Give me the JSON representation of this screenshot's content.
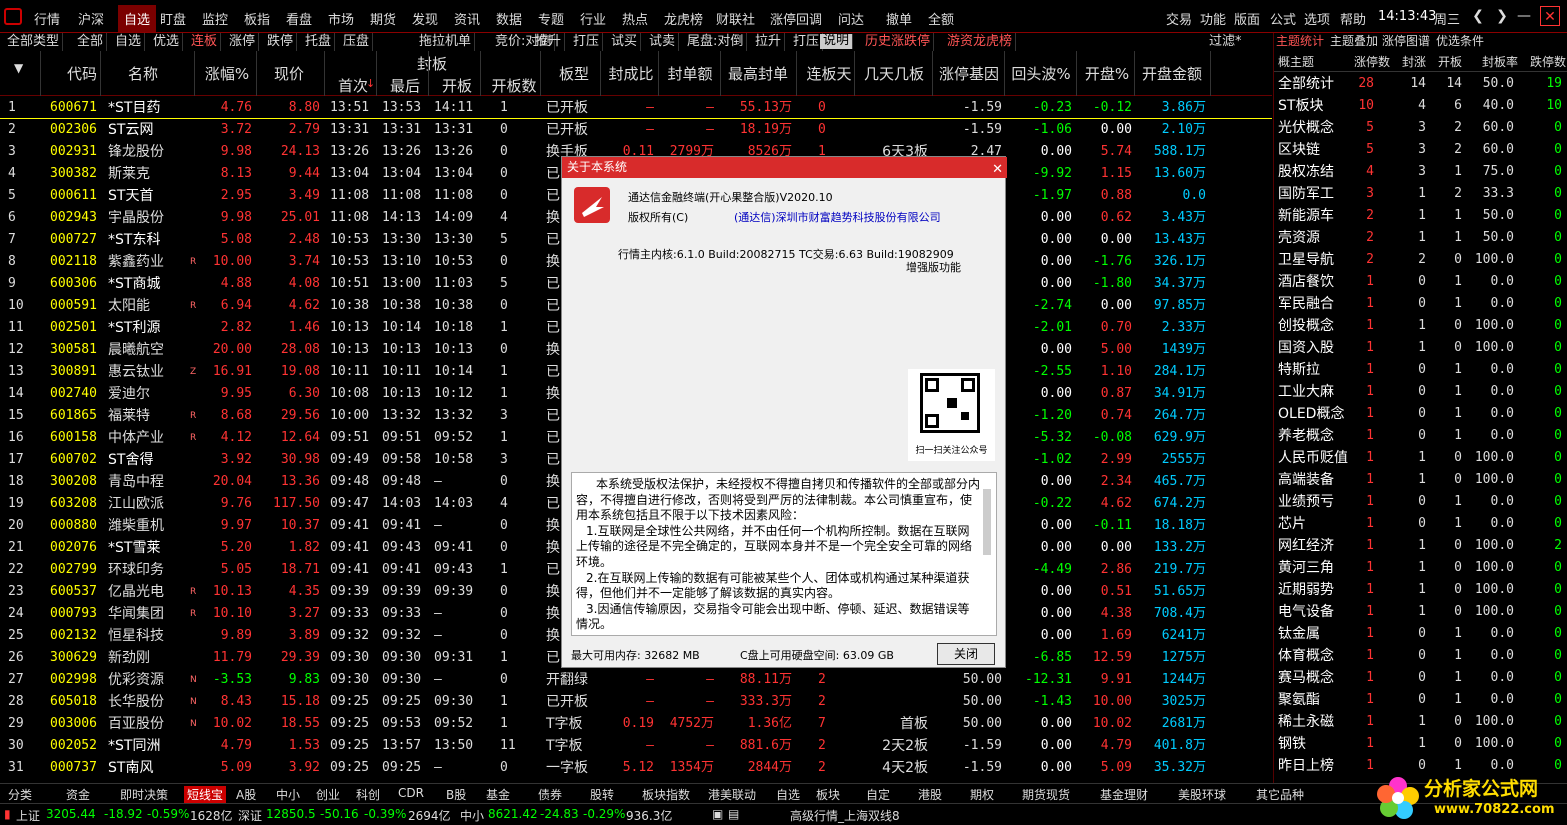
{
  "menu": {
    "items": [
      "行情",
      "沪深",
      "自选",
      "盯盘",
      "监控",
      "板指",
      "看盘",
      "市场",
      "期货",
      "发现",
      "资讯",
      "数据",
      "专题",
      "行业",
      "热点",
      "龙虎榜",
      "财联社",
      "涨停回调",
      "问达",
      "撤单",
      "全额"
    ],
    "right": [
      "交易",
      "功能",
      "版面",
      "公式",
      "选项",
      "帮助"
    ],
    "time": "14:13:43",
    "weekday": "周三"
  },
  "filter": {
    "items": [
      "全部类型",
      "全部",
      "自选",
      "优选",
      "连板",
      "涨停",
      "跌停",
      "托盘",
      "压盘",
      "拖拉机单",
      "竞价:对倒",
      "拉升",
      "打压",
      "试买",
      "试卖",
      "尾盘:对倒",
      "拉升",
      "打压",
      "说明",
      "历史涨跌停",
      "游资龙虎榜"
    ],
    "right": "过滤*"
  },
  "table": {
    "headers": [
      "代码",
      "名称",
      "涨幅%",
      "现价",
      "封板",
      "首次",
      "最后",
      "开板",
      "开板数",
      "板型",
      "封成比",
      "封单额",
      "最高封单",
      "连板天",
      "几天几板",
      "涨停基因",
      "回头波%",
      "开盘%",
      "开盘金额"
    ],
    "rows": [
      [
        "1",
        "600671",
        "*ST目药",
        "",
        "4.76",
        "8.80",
        "13:51",
        "13:53",
        "14:11",
        "1",
        "已开板",
        "–",
        "–",
        "55.13万",
        "0",
        "",
        "-1.59",
        "-0.23",
        "-0.12",
        "3.86万"
      ],
      [
        "2",
        "002306",
        "ST云网",
        "",
        "3.72",
        "2.79",
        "13:31",
        "13:31",
        "13:31",
        "0",
        "已开板",
        "–",
        "–",
        "18.19万",
        "0",
        "",
        "-1.59",
        "-1.06",
        "0.00",
        "2.10万"
      ],
      [
        "3",
        "002931",
        "锋龙股份",
        "",
        "9.98",
        "24.13",
        "13:26",
        "13:26",
        "13:26",
        "0",
        "换手板",
        "0.11",
        "2799万",
        "8526万",
        "1",
        "6天3板",
        "2.47",
        "0.00",
        "5.74",
        "588.1万"
      ],
      [
        "4",
        "300382",
        "斯莱克",
        "",
        "8.13",
        "9.44",
        "13:04",
        "13:04",
        "13:04",
        "0",
        "已",
        "",
        "",
        "",
        "",
        "",
        "",
        "-9.92",
        "1.15",
        "13.60万"
      ],
      [
        "5",
        "000611",
        "ST天首",
        "",
        "2.95",
        "3.49",
        "11:08",
        "11:08",
        "11:08",
        "0",
        "已",
        "",
        "",
        "",
        "",
        "",
        "",
        "-1.97",
        "0.88",
        "0.0"
      ],
      [
        "6",
        "002943",
        "宇晶股份",
        "",
        "9.98",
        "25.01",
        "11:08",
        "14:13",
        "14:09",
        "4",
        "换",
        "",
        "",
        "",
        "",
        "",
        "",
        "0.00",
        "0.62",
        "3.43万"
      ],
      [
        "7",
        "000727",
        "*ST东科",
        "",
        "5.08",
        "2.48",
        "10:53",
        "13:30",
        "13:30",
        "5",
        "已",
        "",
        "",
        "",
        "",
        "",
        "",
        "0.00",
        "0.00",
        "13.43万"
      ],
      [
        "8",
        "002118",
        "紫鑫药业",
        "R",
        "10.00",
        "3.74",
        "10:53",
        "13:10",
        "10:53",
        "0",
        "换",
        "",
        "",
        "",
        "",
        "",
        "",
        "0.00",
        "-1.76",
        "326.1万"
      ],
      [
        "9",
        "600306",
        "*ST商城",
        "",
        "4.88",
        "4.08",
        "10:51",
        "13:00",
        "11:03",
        "5",
        "已",
        "",
        "",
        "",
        "",
        "",
        "",
        "0.00",
        "-1.80",
        "34.37万"
      ],
      [
        "10",
        "000591",
        "太阳能",
        "R",
        "6.94",
        "4.62",
        "10:38",
        "10:38",
        "10:38",
        "0",
        "已",
        "",
        "",
        "",
        "",
        "",
        "",
        "-2.74",
        "0.00",
        "97.85万"
      ],
      [
        "11",
        "002501",
        "*ST利源",
        "",
        "2.82",
        "1.46",
        "10:13",
        "10:14",
        "10:18",
        "1",
        "已",
        "",
        "",
        "",
        "",
        "",
        "",
        "-2.01",
        "0.70",
        "2.33万"
      ],
      [
        "12",
        "300581",
        "晨曦航空",
        "",
        "20.00",
        "28.08",
        "10:13",
        "10:13",
        "10:13",
        "0",
        "换",
        "",
        "",
        "",
        "",
        "",
        "",
        "0.00",
        "5.00",
        "1439万"
      ],
      [
        "13",
        "300891",
        "惠云钛业",
        "Z",
        "16.91",
        "19.08",
        "10:11",
        "10:11",
        "10:14",
        "1",
        "已",
        "",
        "",
        "",
        "",
        "",
        "",
        "-2.55",
        "1.10",
        "284.1万"
      ],
      [
        "14",
        "002740",
        "爱迪尔",
        "",
        "9.95",
        "6.30",
        "10:08",
        "10:13",
        "10:12",
        "1",
        "换",
        "",
        "",
        "",
        "",
        "",
        "",
        "0.00",
        "0.87",
        "34.91万"
      ],
      [
        "15",
        "601865",
        "福莱特",
        "R",
        "8.68",
        "29.56",
        "10:00",
        "13:32",
        "13:32",
        "3",
        "已",
        "",
        "",
        "",
        "",
        "",
        "",
        "-1.20",
        "0.74",
        "264.7万"
      ],
      [
        "16",
        "600158",
        "中体产业",
        "R",
        "4.12",
        "12.64",
        "09:51",
        "09:51",
        "09:52",
        "1",
        "已",
        "",
        "",
        "",
        "",
        "",
        "",
        "-5.32",
        "-0.08",
        "629.9万"
      ],
      [
        "17",
        "600702",
        "ST舍得",
        "",
        "3.92",
        "30.98",
        "09:49",
        "09:58",
        "10:58",
        "3",
        "已",
        "",
        "",
        "",
        "",
        "",
        "",
        "-1.02",
        "2.99",
        "2555万"
      ],
      [
        "18",
        "300208",
        "青岛中程",
        "",
        "20.04",
        "13.36",
        "09:48",
        "09:48",
        "–",
        "0",
        "换",
        "",
        "",
        "",
        "",
        "",
        "",
        "0.00",
        "2.34",
        "465.7万"
      ],
      [
        "19",
        "603208",
        "江山欧派",
        "",
        "9.76",
        "117.50",
        "09:47",
        "14:03",
        "14:03",
        "4",
        "已",
        "",
        "",
        "",
        "",
        "",
        "",
        "-0.22",
        "4.62",
        "674.2万"
      ],
      [
        "20",
        "000880",
        "潍柴重机",
        "",
        "9.97",
        "10.37",
        "09:41",
        "09:41",
        "–",
        "0",
        "换",
        "",
        "",
        "",
        "",
        "",
        "",
        "0.00",
        "-0.11",
        "18.18万"
      ],
      [
        "21",
        "002076",
        "*ST雪莱",
        "",
        "5.20",
        "1.82",
        "09:41",
        "09:43",
        "09:41",
        "0",
        "换",
        "",
        "",
        "",
        "",
        "",
        "",
        "0.00",
        "0.00",
        "133.2万"
      ],
      [
        "22",
        "002799",
        "环球印务",
        "",
        "5.05",
        "18.71",
        "09:41",
        "09:41",
        "09:43",
        "1",
        "已",
        "",
        "",
        "",
        "",
        "",
        "",
        "-4.49",
        "2.86",
        "219.7万"
      ],
      [
        "23",
        "600537",
        "亿晶光电",
        "R",
        "10.13",
        "4.35",
        "09:39",
        "09:39",
        "09:39",
        "0",
        "换",
        "",
        "",
        "",
        "",
        "",
        "",
        "0.00",
        "0.51",
        "51.65万"
      ],
      [
        "24",
        "000793",
        "华闻集团",
        "R",
        "10.10",
        "3.27",
        "09:33",
        "09:33",
        "–",
        "0",
        "换",
        "",
        "",
        "",
        "",
        "",
        "",
        "0.00",
        "4.38",
        "708.4万"
      ],
      [
        "25",
        "002132",
        "恒星科技",
        "",
        "9.89",
        "3.89",
        "09:32",
        "09:32",
        "–",
        "0",
        "换",
        "",
        "",
        "",
        "",
        "",
        "",
        "0.00",
        "1.69",
        "6241万"
      ],
      [
        "26",
        "300629",
        "新劲刚",
        "",
        "11.79",
        "29.39",
        "09:30",
        "09:30",
        "09:31",
        "1",
        "已",
        "",
        "",
        "",
        "",
        "",
        "",
        "-6.85",
        "12.59",
        "1275万"
      ],
      [
        "27",
        "002998",
        "优彩资源",
        "N",
        "-3.53",
        "9.83",
        "09:30",
        "09:30",
        "–",
        "0",
        "开翻绿",
        "–",
        "–",
        "88.11万",
        "2",
        "",
        "50.00",
        "-12.31",
        "9.91",
        "1244万"
      ],
      [
        "28",
        "605018",
        "长华股份",
        "N",
        "8.43",
        "15.18",
        "09:25",
        "09:25",
        "09:30",
        "1",
        "已开板",
        "–",
        "–",
        "333.3万",
        "2",
        "",
        "50.00",
        "-1.43",
        "10.00",
        "3025万"
      ],
      [
        "29",
        "003006",
        "百亚股份",
        "N",
        "10.02",
        "18.55",
        "09:25",
        "09:53",
        "09:52",
        "1",
        "T字板",
        "0.19",
        "4752万",
        "1.36亿",
        "7",
        "首板",
        "50.00",
        "0.00",
        "10.02",
        "2681万"
      ],
      [
        "30",
        "002052",
        "*ST同洲",
        "",
        "4.79",
        "1.53",
        "09:25",
        "13:57",
        "13:50",
        "11",
        "T字板",
        "–",
        "–",
        "881.6万",
        "2",
        "2天2板",
        "-1.59",
        "0.00",
        "4.79",
        "401.8万"
      ],
      [
        "31",
        "000737",
        "ST南风",
        "",
        "5.09",
        "3.92",
        "09:25",
        "09:25",
        "–",
        "0",
        "一字板",
        "5.12",
        "1354万",
        "2844万",
        "2",
        "4天2板",
        "-1.59",
        "0.00",
        "5.09",
        "35.32万"
      ]
    ]
  },
  "right_panel": {
    "tabs": [
      "主题统计",
      "主题叠加",
      "涨停图谱",
      "优选条件"
    ],
    "headers": [
      "概主题",
      "涨停数",
      "封涨",
      "开板",
      "封板率",
      "跌停数"
    ],
    "rows": [
      [
        "全部统计",
        "28",
        "14",
        "14",
        "50.0",
        "19"
      ],
      [
        "ST板块",
        "10",
        "4",
        "6",
        "40.0",
        "10"
      ],
      [
        "光伏概念",
        "5",
        "3",
        "2",
        "60.0",
        "0"
      ],
      [
        "区块链",
        "5",
        "3",
        "2",
        "60.0",
        "0"
      ],
      [
        "股权冻结",
        "4",
        "3",
        "1",
        "75.0",
        "0"
      ],
      [
        "国防军工",
        "3",
        "1",
        "2",
        "33.3",
        "0"
      ],
      [
        "新能源车",
        "2",
        "1",
        "1",
        "50.0",
        "0"
      ],
      [
        "壳资源",
        "2",
        "1",
        "1",
        "50.0",
        "0"
      ],
      [
        "卫星导航",
        "2",
        "2",
        "0",
        "100.0",
        "0"
      ],
      [
        "酒店餐饮",
        "1",
        "0",
        "1",
        "0.0",
        "0"
      ],
      [
        "军民融合",
        "1",
        "0",
        "1",
        "0.0",
        "0"
      ],
      [
        "创投概念",
        "1",
        "1",
        "0",
        "100.0",
        "0"
      ],
      [
        "国资入股",
        "1",
        "1",
        "0",
        "100.0",
        "0"
      ],
      [
        "特斯拉",
        "1",
        "0",
        "1",
        "0.0",
        "0"
      ],
      [
        "工业大麻",
        "1",
        "0",
        "1",
        "0.0",
        "0"
      ],
      [
        "OLED概念",
        "1",
        "0",
        "1",
        "0.0",
        "0"
      ],
      [
        "养老概念",
        "1",
        "0",
        "1",
        "0.0",
        "0"
      ],
      [
        "人民币贬值",
        "1",
        "1",
        "0",
        "100.0",
        "0"
      ],
      [
        "高端装备",
        "1",
        "1",
        "0",
        "100.0",
        "0"
      ],
      [
        "业绩预亏",
        "1",
        "0",
        "1",
        "0.0",
        "0"
      ],
      [
        "芯片",
        "1",
        "0",
        "1",
        "0.0",
        "0"
      ],
      [
        "网红经济",
        "1",
        "1",
        "0",
        "100.0",
        "2"
      ],
      [
        "黄河三角",
        "1",
        "1",
        "0",
        "100.0",
        "0"
      ],
      [
        "近期弱势",
        "1",
        "1",
        "0",
        "100.0",
        "0"
      ],
      [
        "电气设备",
        "1",
        "1",
        "0",
        "100.0",
        "0"
      ],
      [
        "钛金属",
        "1",
        "0",
        "1",
        "0.0",
        "0"
      ],
      [
        "体育概念",
        "1",
        "0",
        "1",
        "0.0",
        "0"
      ],
      [
        "赛马概念",
        "1",
        "0",
        "1",
        "0.0",
        "0"
      ],
      [
        "聚氨酯",
        "1",
        "0",
        "1",
        "0.0",
        "0"
      ],
      [
        "稀土永磁",
        "1",
        "1",
        "0",
        "100.0",
        "0"
      ],
      [
        "钢铁",
        "1",
        "1",
        "0",
        "100.0",
        "0"
      ],
      [
        "昨日上榜",
        "1",
        "0",
        "1",
        "0.0",
        "0"
      ]
    ]
  },
  "bottom_tabs": [
    "分类",
    "资金",
    "即时决策",
    "短线宝",
    "A股",
    "中小",
    "创业",
    "科创",
    "CDR",
    "B股",
    "基金",
    "债券",
    "股转",
    "板块指数",
    "港美联动",
    "自选",
    "板块",
    "自定",
    "港股",
    "期权",
    "期货现货",
    "基金理财",
    "美股环球",
    "其它品种"
  ],
  "status": {
    "sh_label": "上证",
    "sh_val": "3205.44",
    "sh_chg": "-18.92",
    "sh_pct": "-0.59%",
    "sh_amt": "1628亿",
    "sz_label": "深证",
    "sz_val": "12850.5",
    "sz_chg": "-50.16",
    "sz_pct": "-0.39%",
    "sz_amt": "2694亿",
    "zx_label": "中小",
    "zx_val": "8621.42",
    "zx_chg": "-24.83",
    "zx_pct": "-0.29%",
    "zx_amt": "936.3亿",
    "feed": "高级行情_上海双线8"
  },
  "brand": {
    "name": "分析家公式网",
    "url": "www.70822.com"
  },
  "dialog": {
    "title": "关于本系统",
    "product": "通达信金融终端(开心果整合版)V2020.10",
    "copyright": "版权所有(C)",
    "company": "(通达信)深圳市财富趋势科技股份有限公司",
    "kernel": "行情主内核:6.1.0 Build:20082715 TC交易:6.63 Build:19082909",
    "enhanced": "增强版功能",
    "qr_caption": "扫一扫关注公众号",
    "disclaimer": "本系统受版权法保护，未经授权不得擅自拷贝和传播软件的全部或部分内容，不得擅自进行修改，否则将受到严厉的法律制裁。本公司慎重宣布，使用本系统包括且不限于以下技术因素风险：\n1.互联网是全球性公共网络，并不由任何一个机构所控制。数据在互联网上传输的途径是不完全确定的，互联网本身并不是一个完全安全可靠的网络环境。\n2.在互联网上传输的数据有可能被某些个人、团体或机构通过某种渠道获得，但他们并不一定能够了解该数据的真实内容。\n3.因通信传输原因，交易指令可能会出现中断、停顿、延迟、数据错误等情况。",
    "memory": "最大可用内存: 32682 MB",
    "disk": "C盘上可用硬盘空间: 63.09 GB",
    "close_label": "关闭"
  },
  "colors": {
    "up": "#ff3333",
    "down": "#00ff00",
    "accent": "#d82b2b",
    "code": "#ffff00"
  }
}
